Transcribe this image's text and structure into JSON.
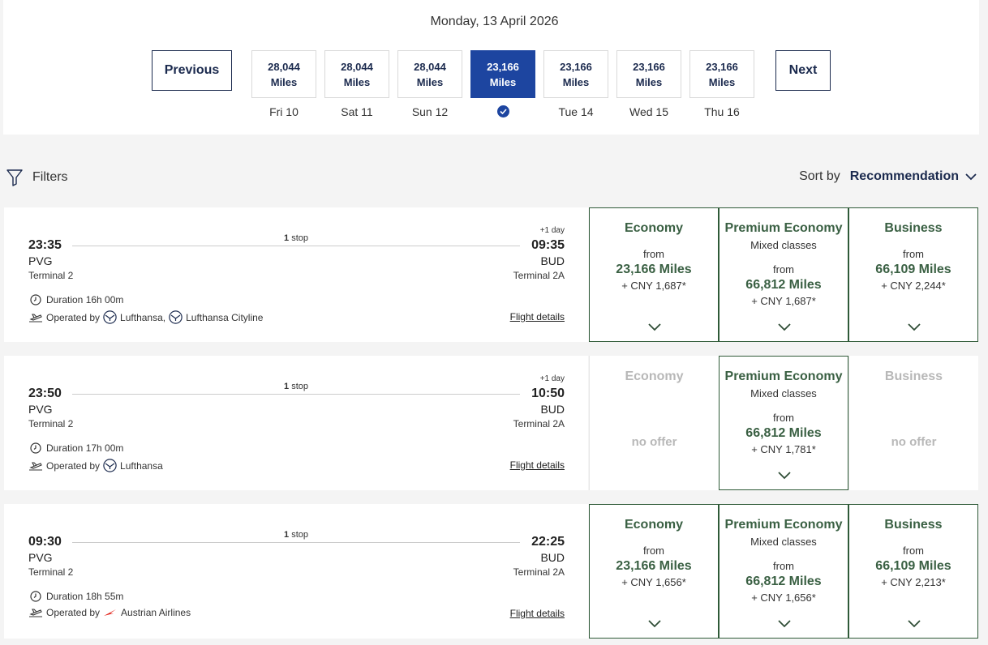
{
  "header": {
    "date": "Monday, 13 April 2026",
    "previous_label": "Previous",
    "next_label": "Next",
    "days": [
      {
        "miles": "28,044",
        "unit": "Miles",
        "label": "Fri 10",
        "active": false
      },
      {
        "miles": "28,044",
        "unit": "Miles",
        "label": "Sat 11",
        "active": false
      },
      {
        "miles": "28,044",
        "unit": "Miles",
        "label": "Sun 12",
        "active": false
      },
      {
        "miles": "23,166",
        "unit": "Miles",
        "label": "",
        "active": true
      },
      {
        "miles": "23,166",
        "unit": "Miles",
        "label": "Tue 14",
        "active": false
      },
      {
        "miles": "23,166",
        "unit": "Miles",
        "label": "Wed 15",
        "active": false
      },
      {
        "miles": "23,166",
        "unit": "Miles",
        "label": "Thu 16",
        "active": false
      }
    ]
  },
  "toolbar": {
    "filters_label": "Filters",
    "sort_label": "Sort by",
    "sort_value": "Recommendation"
  },
  "colors": {
    "primary": "#1d45a0",
    "navy": "#1b2a4e",
    "fare_green": "#3a6043",
    "lufthansa": "#1b2a4e",
    "austrian": "#e2231a"
  },
  "flights": [
    {
      "dep_time": "23:35",
      "dep_airport": "PVG",
      "dep_terminal": "Terminal 2",
      "arr_time": "09:35",
      "arr_airport": "BUD",
      "arr_terminal": "Terminal 2A",
      "plus_day": "+1 day",
      "stops_num": "1",
      "stops_text": "stop",
      "duration": "Duration 16h 00m",
      "operated_label": "Operated by",
      "carriers": [
        "Lufthansa,",
        "Lufthansa Cityline"
      ],
      "carrier_icon": "crane-icon",
      "details_label": "Flight details",
      "fares": {
        "economy": {
          "title": "Economy",
          "from": "from",
          "miles": "23,166 Miles",
          "tax": "+ CNY 1,687*"
        },
        "premium": {
          "title": "Premium Economy",
          "sub": "Mixed classes",
          "from": "from",
          "miles": "66,812 Miles",
          "tax": "+ CNY 1,687*"
        },
        "business": {
          "title": "Business",
          "from": "from",
          "miles": "66,109 Miles",
          "tax": "+ CNY 2,244*"
        }
      }
    },
    {
      "dep_time": "23:50",
      "dep_airport": "PVG",
      "dep_terminal": "Terminal 2",
      "arr_time": "10:50",
      "arr_airport": "BUD",
      "arr_terminal": "Terminal 2A",
      "plus_day": "+1 day",
      "stops_num": "1",
      "stops_text": "stop",
      "duration": "Duration 17h 00m",
      "operated_label": "Operated by",
      "carriers": [
        "Lufthansa"
      ],
      "carrier_icon": "crane-icon",
      "details_label": "Flight details",
      "fares": {
        "economy": {
          "title": "Economy",
          "no_offer": "no offer"
        },
        "premium": {
          "title": "Premium Economy",
          "sub": "Mixed classes",
          "from": "from",
          "miles": "66,812 Miles",
          "tax": "+ CNY 1,781*"
        },
        "business": {
          "title": "Business",
          "no_offer": "no offer"
        }
      }
    },
    {
      "dep_time": "09:30",
      "dep_airport": "PVG",
      "dep_terminal": "Terminal 2",
      "arr_time": "22:25",
      "arr_airport": "BUD",
      "arr_terminal": "Terminal 2A",
      "plus_day": "",
      "stops_num": "1",
      "stops_text": "stop",
      "duration": "Duration 18h 55m",
      "operated_label": "Operated by",
      "carriers": [
        "Austrian Airlines"
      ],
      "carrier_icon": "austrian-arrow-icon",
      "details_label": "Flight details",
      "fares": {
        "economy": {
          "title": "Economy",
          "from": "from",
          "miles": "23,166 Miles",
          "tax": "+ CNY 1,656*"
        },
        "premium": {
          "title": "Premium Economy",
          "sub": "Mixed classes",
          "from": "from",
          "miles": "66,812 Miles",
          "tax": "+ CNY 1,656*"
        },
        "business": {
          "title": "Business",
          "from": "from",
          "miles": "66,109 Miles",
          "tax": "+ CNY 2,213*"
        }
      }
    }
  ]
}
